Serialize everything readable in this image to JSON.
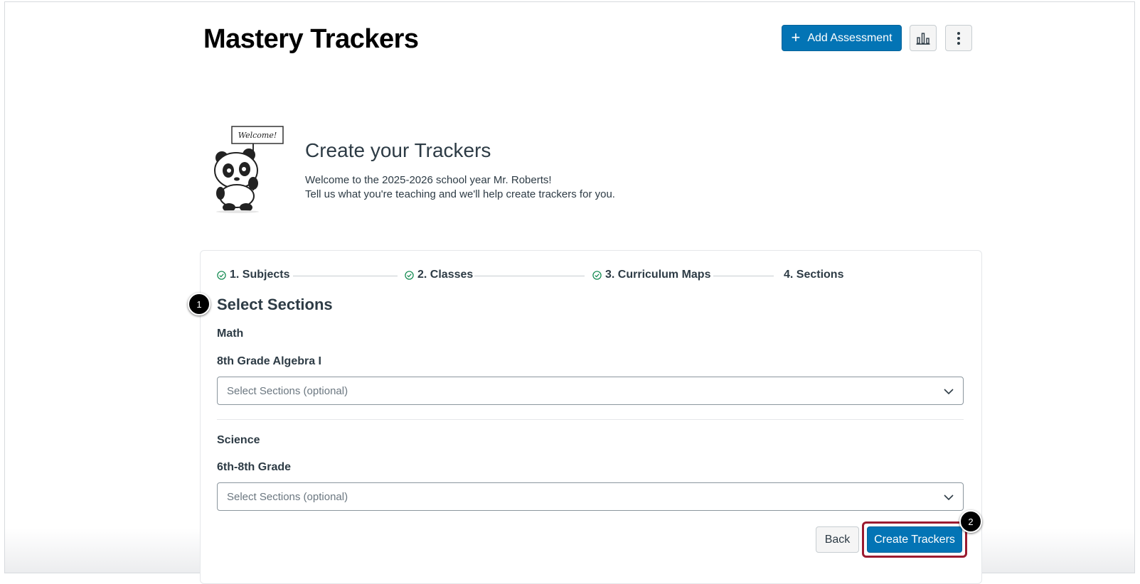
{
  "header": {
    "title": "Mastery Trackers",
    "add_assessment_label": "Add Assessment",
    "chart_icon": "bar-chart-icon",
    "more_icon": "vertical-ellipsis-icon"
  },
  "welcome": {
    "sign_text": "Welcome!",
    "title": "Create your Trackers",
    "line1": "Welcome to the 2025-2026 school year Mr. Roberts!",
    "line2": "Tell us what you're teaching and we'll help create trackers for you."
  },
  "steps": [
    {
      "label": "1. Subjects",
      "completed": true
    },
    {
      "label": "2. Classes",
      "completed": true
    },
    {
      "label": "3. Curriculum Maps",
      "completed": true
    },
    {
      "label": "4. Sections",
      "completed": false
    }
  ],
  "form": {
    "heading": "Select Sections",
    "groups": [
      {
        "subject": "Math",
        "class_name": "8th Grade Algebra I",
        "placeholder": "Select Sections (optional)"
      },
      {
        "subject": "Science",
        "class_name": "6th-8th Grade",
        "placeholder": "Select Sections (optional)"
      }
    ],
    "back_label": "Back",
    "create_label": "Create Trackers"
  },
  "callouts": [
    "1",
    "2"
  ],
  "colors": {
    "primary": "#0374b5",
    "success": "#0b874b",
    "highlight": "#9b1b30",
    "text": "#2d3b45"
  }
}
